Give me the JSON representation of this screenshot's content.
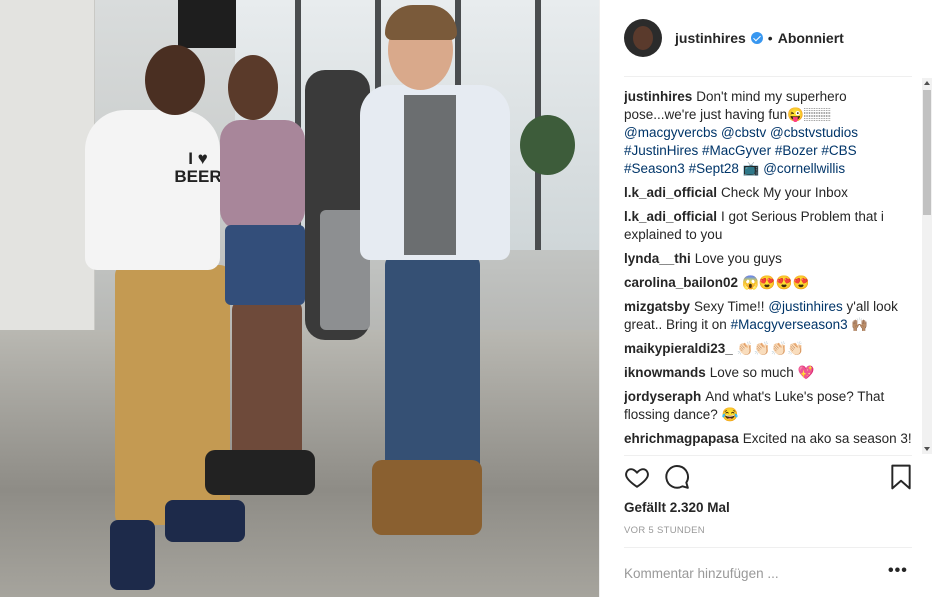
{
  "post": {
    "username": "justinhires",
    "follow_status": "Abonniert",
    "dot": "•",
    "photo": {
      "shirt_text": "I ♥ BEER"
    },
    "comments": [
      {
        "user": "justinhires",
        "parts": [
          {
            "t": "Don't mind my superhero pose...we're just having fun😜🏽🏽 "
          },
          {
            "t": "@macgyvercbs",
            "link": true
          },
          {
            "t": " "
          },
          {
            "t": "@cbstv",
            "link": true
          },
          {
            "t": " "
          },
          {
            "t": "@cbstvstudios",
            "link": true
          },
          {
            "t": " "
          },
          {
            "t": "#JustinHires",
            "link": true
          },
          {
            "t": " "
          },
          {
            "t": "#MacGyver",
            "link": true
          },
          {
            "t": " "
          },
          {
            "t": "#Bozer",
            "link": true
          },
          {
            "t": " "
          },
          {
            "t": "#CBS",
            "link": true
          },
          {
            "t": " "
          },
          {
            "t": "#Season3",
            "link": true
          },
          {
            "t": " "
          },
          {
            "t": "#Sept28",
            "link": true
          },
          {
            "t": " 📺 "
          },
          {
            "t": "@cornellwillis",
            "link": true
          }
        ]
      },
      {
        "user": "l.k_adi_official",
        "parts": [
          {
            "t": "Check My your Inbox"
          }
        ]
      },
      {
        "user": "l.k_adi_official",
        "parts": [
          {
            "t": "I got Serious Problem that i explained to you"
          }
        ]
      },
      {
        "user": "lynda__thi",
        "parts": [
          {
            "t": "Love you guys"
          }
        ]
      },
      {
        "user": "carolina_bailon02",
        "parts": [
          {
            "t": "😱😍😍😍"
          }
        ]
      },
      {
        "user": "mizgatsby",
        "parts": [
          {
            "t": "Sexy Time!! "
          },
          {
            "t": "@justinhires",
            "link": true
          },
          {
            "t": " y'all look great.. Bring it on "
          },
          {
            "t": "#Macgyverseason3",
            "link": true
          },
          {
            "t": " 🙌🏽"
          }
        ]
      },
      {
        "user": "maikypieraldi23_",
        "parts": [
          {
            "t": "👏🏻👏🏻👏🏻👏🏻"
          }
        ]
      },
      {
        "user": "iknowmands",
        "parts": [
          {
            "t": "Love so much 💖"
          }
        ]
      },
      {
        "user": "jordyseraph",
        "parts": [
          {
            "t": "And what's Luke's pose? That flossing dance? 😂"
          }
        ]
      },
      {
        "user": "ehrichmagpapasa",
        "parts": [
          {
            "t": "Excited na ako sa season 3!"
          }
        ]
      }
    ],
    "likes": "Gefällt 2.320 Mal",
    "time": "VOR 5 STUNDEN",
    "add_comment_placeholder": "Kommentar hinzufügen ...",
    "more_label": "•••",
    "icons": {
      "like": "heart-icon",
      "comment": "speech-bubble-icon",
      "save": "bookmark-icon",
      "verified": "verified-badge-icon"
    },
    "colors": {
      "link": "#003569",
      "verified": "#3897f0",
      "meta": "#999999"
    }
  }
}
